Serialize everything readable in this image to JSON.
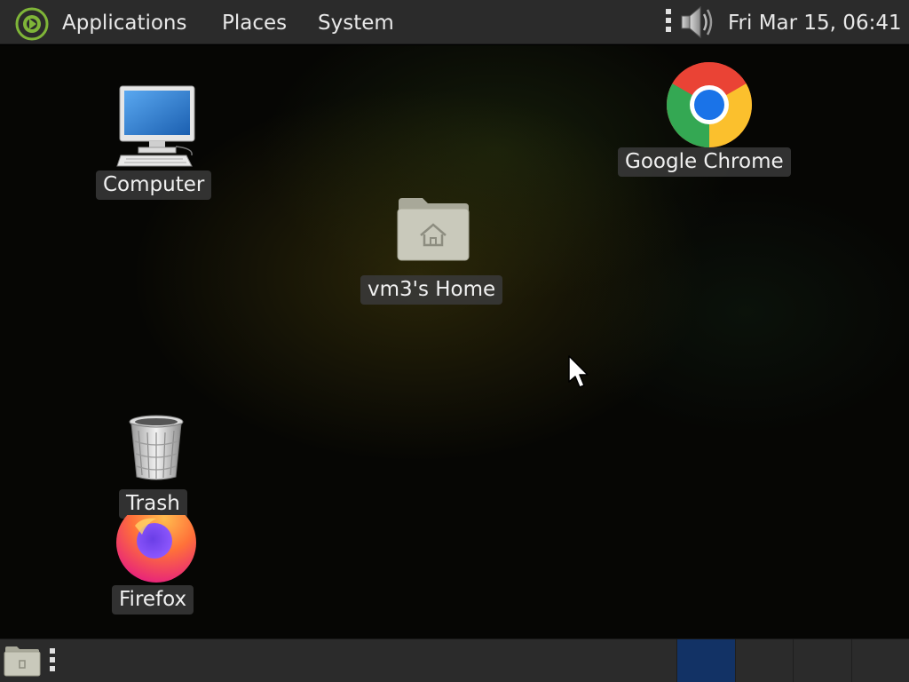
{
  "top_panel": {
    "menus": {
      "applications": "Applications",
      "places": "Places",
      "system": "System"
    },
    "clock": "Fri Mar 15, 06:41"
  },
  "desktop": {
    "icons": {
      "computer": "Computer",
      "home": "vm3's Home",
      "chrome": "Google Chrome",
      "trash": "Trash",
      "firefox": "Firefox"
    }
  },
  "bottom_panel": {
    "workspaces": [
      "1",
      "2",
      "3",
      "4"
    ],
    "active_workspace": 1
  },
  "colors": {
    "panel": "#2b2b2b",
    "active_workspace": "#123265",
    "label_bg": "#3a3a3a"
  }
}
